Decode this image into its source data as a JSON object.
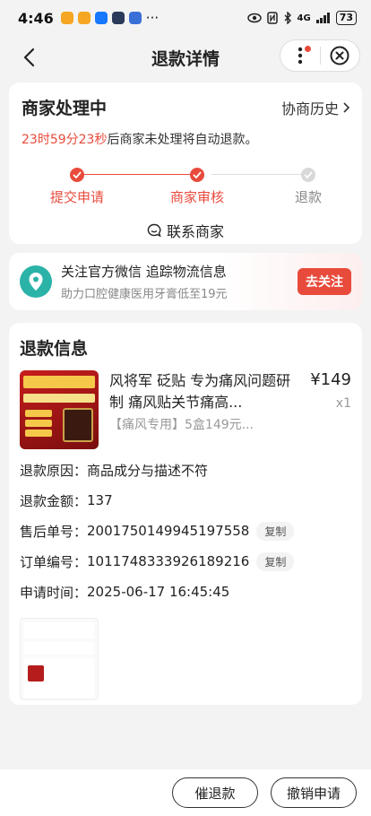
{
  "status_bar": {
    "time": "4:46",
    "more": "···",
    "network": "4G",
    "battery": "73"
  },
  "nav": {
    "title": "退款详情"
  },
  "status": {
    "title": "商家处理中",
    "history_label": "协商历史",
    "countdown": "23时59分23秒",
    "countdown_suffix": "后商家未处理将自动退款。",
    "steps": [
      {
        "label": "提交申请",
        "state": "done"
      },
      {
        "label": "商家审核",
        "state": "done"
      },
      {
        "label": "退款",
        "state": "pending"
      }
    ],
    "contact_label": "联系商家"
  },
  "follow": {
    "title": "关注官方微信 追踪物流信息",
    "subtitle": "助力口腔健康医用牙膏低至19元",
    "button": "去关注"
  },
  "refund": {
    "title": "退款信息",
    "product": {
      "name": "风将军 砭贴 专为痛风问题研制 痛风贴关节痛高...",
      "spec": "【痛风专用】5盒149元...",
      "price": "¥149",
      "qty": "x1",
      "thumb_text": "风将军痛风康贴"
    },
    "fields": [
      {
        "label": "退款原因：",
        "value": "商品成分与描述不符"
      },
      {
        "label": "退款金额：",
        "value": "137"
      },
      {
        "label": "售后单号：",
        "value": "2001750149945197558",
        "copy": "复制"
      },
      {
        "label": "订单编号：",
        "value": "1011748333926189216",
        "copy": "复制"
      },
      {
        "label": "申请时间：",
        "value": "2025-06-17 16:45:45"
      }
    ]
  },
  "actions": {
    "urge": "催退款",
    "cancel": "撤销申请"
  },
  "colors": {
    "accent": "#e84b3c",
    "follow_icon": "#2bb3a8"
  }
}
